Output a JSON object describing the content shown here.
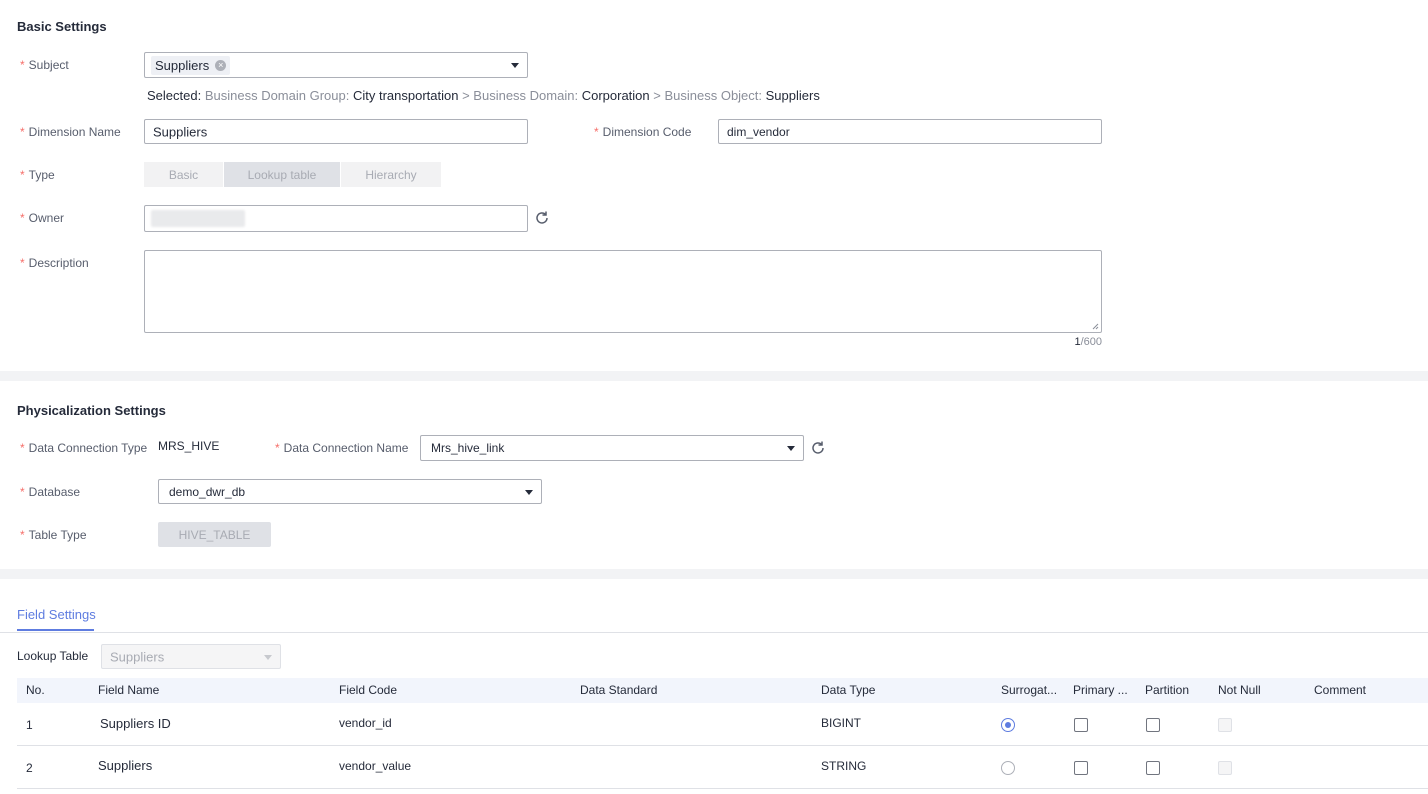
{
  "basic": {
    "title": "Basic Settings",
    "subject": {
      "label": "Subject",
      "tag": "Suppliers"
    },
    "selected": {
      "prefix": "Selected:",
      "group_label": "Business Domain Group:",
      "group_value": "City transportation",
      "domain_label": "> Business Domain:",
      "domain_value": "Corporation",
      "object_label": "> Business Object:",
      "object_value": "Suppliers"
    },
    "dimension_name": {
      "label": "Dimension Name",
      "value": "Suppliers"
    },
    "dimension_code": {
      "label": "Dimension Code",
      "value": "dim_vendor"
    },
    "type": {
      "label": "Type",
      "options": [
        "Basic",
        "Lookup table",
        "Hierarchy"
      ],
      "selected": "Lookup table"
    },
    "owner": {
      "label": "Owner"
    },
    "description": {
      "label": "Description",
      "count_current": "1",
      "count_max": "/600"
    }
  },
  "phys": {
    "title": "Physicalization Settings",
    "conn_type": {
      "label": "Data Connection Type",
      "value": "MRS_HIVE"
    },
    "conn_name": {
      "label": "Data Connection Name",
      "value": "Mrs_hive_link"
    },
    "database": {
      "label": "Database",
      "value": "demo_dwr_db"
    },
    "table_type": {
      "label": "Table Type",
      "value": "HIVE_TABLE"
    }
  },
  "fields": {
    "tab": "Field Settings",
    "lookup_label": "Lookup Table",
    "lookup_value": "Suppliers",
    "columns": [
      "No.",
      "Field Name",
      "Field Code",
      "Data Standard",
      "Data Type",
      "Surrogat...",
      "Primary ...",
      "Partition",
      "Not Null",
      "Comment"
    ],
    "rows": [
      {
        "no": "1",
        "name": "Suppliers ID",
        "code": "vendor_id",
        "standard": "",
        "type": "BIGINT",
        "surrogate": true
      },
      {
        "no": "2",
        "name": "Suppliers",
        "code": "vendor_value",
        "standard": "",
        "type": "STRING",
        "surrogate": false
      }
    ]
  },
  "colors": {
    "accent": "#5e7ce0",
    "required": "#f66f6a",
    "band": "#f2f3f5"
  }
}
